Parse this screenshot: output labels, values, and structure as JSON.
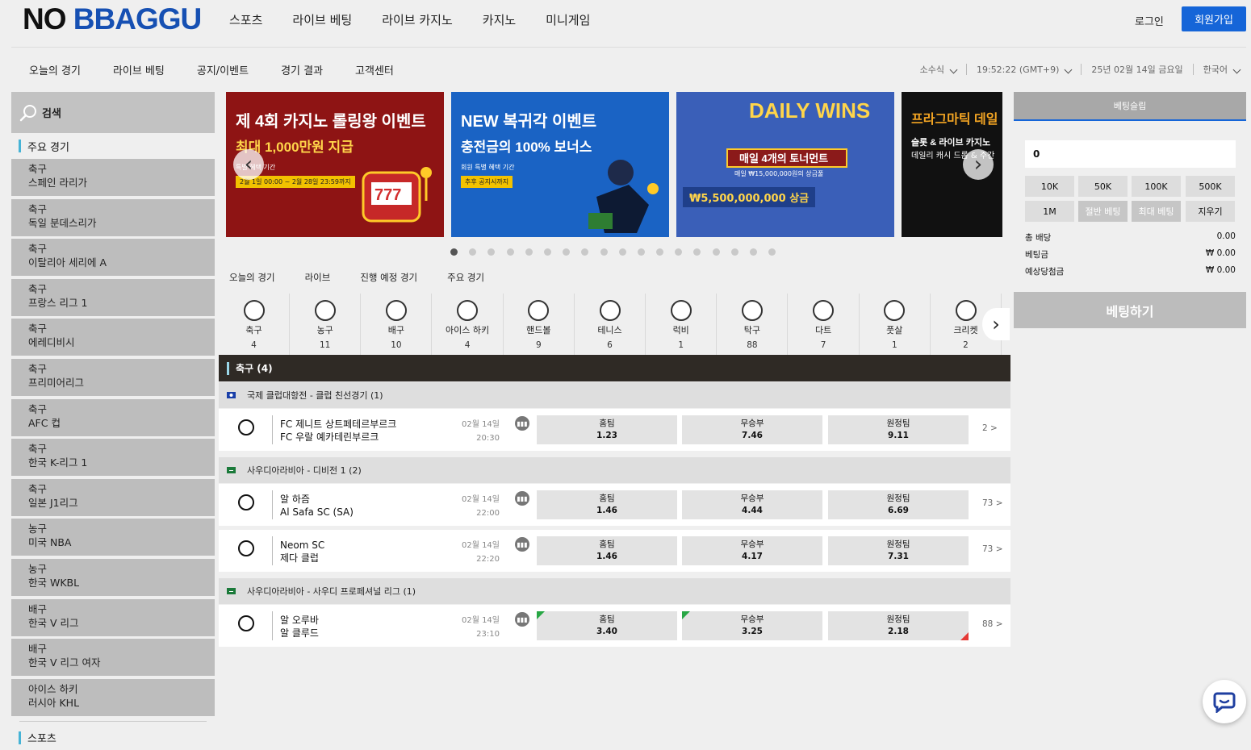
{
  "header": {
    "logo_a": "NO ",
    "logo_b": "BBAGGU",
    "nav": [
      "스포츠",
      "라이브 베팅",
      "라이브 카지노",
      "카지노",
      "미니게임"
    ],
    "login": "로그인",
    "join": "회원가입",
    "join_color": "#1565d8"
  },
  "subbar": {
    "nav": [
      "오늘의 경기",
      "라이브 베팅",
      "공지/이벤트",
      "경기 결과",
      "고객센터"
    ],
    "odds_format": "소수식",
    "clock": "19:52:22 (GMT+9)",
    "date": "25년 02월 14일 금요일",
    "language": "한국어"
  },
  "sidebar": {
    "search_label": "검색",
    "section_main": "주요 경기",
    "leagues": [
      {
        "sport": "축구",
        "name": "스페인 라리가"
      },
      {
        "sport": "축구",
        "name": "독일 분데스리가"
      },
      {
        "sport": "축구",
        "name": "이탈리아 세리에 A"
      },
      {
        "sport": "축구",
        "name": "프랑스 리그 1"
      },
      {
        "sport": "축구",
        "name": "에레디비시"
      },
      {
        "sport": "축구",
        "name": "프리미어리그"
      },
      {
        "sport": "축구",
        "name": "AFC 컵"
      },
      {
        "sport": "축구",
        "name": "한국 K-리그 1"
      },
      {
        "sport": "축구",
        "name": "일본 J1리그"
      },
      {
        "sport": "농구",
        "name": "미국 NBA"
      },
      {
        "sport": "농구",
        "name": "한국 WKBL"
      },
      {
        "sport": "배구",
        "name": "한국 V 리그"
      },
      {
        "sport": "배구",
        "name": "한국 V 리그 여자"
      },
      {
        "sport": "아이스 하키",
        "name": "러시아 KHL"
      }
    ],
    "section_sports": "스포츠"
  },
  "banners": [
    {
      "title": "제 4회 카지노 롤링왕 이벤트",
      "sub": "최대 1,000만원 지급",
      "note": "특별 혜택 기간",
      "tag": "2월 1일 00:00 ~ 2월 28일 23:59까지",
      "bg": "#8e1414"
    },
    {
      "title": "NEW 복귀각 이벤트",
      "sub": "충전금의 100% 보너스",
      "note": "회원 특별 혜택 기간",
      "tag": "추후 공지시까지",
      "bg": "#1a63c4"
    },
    {
      "title": "DAILY WINS",
      "sub": "매일 4개의 토너먼트",
      "note": "매일 ₩15,000,000원의 상금풀",
      "tag": "₩5,500,000,000 상금",
      "bg": "#3a5fb8"
    },
    {
      "title": "프라그마틱 데일",
      "sub": "슬롯 & 라이브 카지노",
      "note": "데일리 캐시 드롭 & 주간",
      "tag": "",
      "bg": "#111111"
    }
  ],
  "slider": {
    "total_dots": 18,
    "active_dot": 1
  },
  "game_tabs": [
    "오늘의 경기",
    "라이브",
    "진행 예정 경기",
    "주요 경기"
  ],
  "sports": [
    {
      "name": "축구",
      "count": "4"
    },
    {
      "name": "농구",
      "count": "11"
    },
    {
      "name": "배구",
      "count": "10"
    },
    {
      "name": "아이스 하키",
      "count": "4"
    },
    {
      "name": "핸드볼",
      "count": "9"
    },
    {
      "name": "테니스",
      "count": "6"
    },
    {
      "name": "럭비",
      "count": "1"
    },
    {
      "name": "탁구",
      "count": "88"
    },
    {
      "name": "다트",
      "count": "7"
    },
    {
      "name": "풋살",
      "count": "1"
    },
    {
      "name": "크리켓",
      "count": "2"
    }
  ],
  "sport_header": "축구 (4)",
  "leagues": [
    {
      "title": "국제 클럽대항전 - 클럽 친선경기 (1)"
    },
    {
      "title": "사우디아라비아 - 디비전 1 (2)"
    },
    {
      "title": "사우디아라비아 - 사우디 프로페셔널 리그 (1)"
    }
  ],
  "odd_labels": {
    "home": "홈팀",
    "draw": "무승부",
    "away": "원정팀"
  },
  "matches": [
    {
      "home": "FC 제니트 상트페테르부르크",
      "away": "FC 우랄 예카테린부르크",
      "date": "02월 14일",
      "time": "20:30",
      "odds": [
        "1.23",
        "7.46",
        "9.11"
      ],
      "more": "2 >"
    },
    {
      "home": "알 하즘",
      "away": "Al Safa SC (SA)",
      "date": "02월 14일",
      "time": "22:00",
      "odds": [
        "1.46",
        "4.44",
        "6.69"
      ],
      "more": "73 >"
    },
    {
      "home": "Neom SC",
      "away": "제다 클럽",
      "date": "02월 14일",
      "time": "22:20",
      "odds": [
        "1.46",
        "4.17",
        "7.31"
      ],
      "more": "73 >"
    },
    {
      "home": "알 오루바",
      "away": "알 클루드",
      "date": "02월 14일",
      "time": "23:10",
      "odds": [
        "3.40",
        "3.25",
        "2.18"
      ],
      "more": "88 >"
    }
  ],
  "betslip": {
    "title": "베팅슬립",
    "amount": "0",
    "chips": [
      "10K",
      "50K",
      "100K",
      "500K",
      "1M",
      "절반 베팅",
      "최대 베팅",
      "지우기"
    ],
    "rows": [
      {
        "label": "총 배당",
        "value": "0.00"
      },
      {
        "label": "베팅금",
        "value": "₩ 0.00"
      },
      {
        "label": "예상당첨금",
        "value": "₩ 0.00"
      }
    ],
    "bet_button": "베팅하기"
  }
}
